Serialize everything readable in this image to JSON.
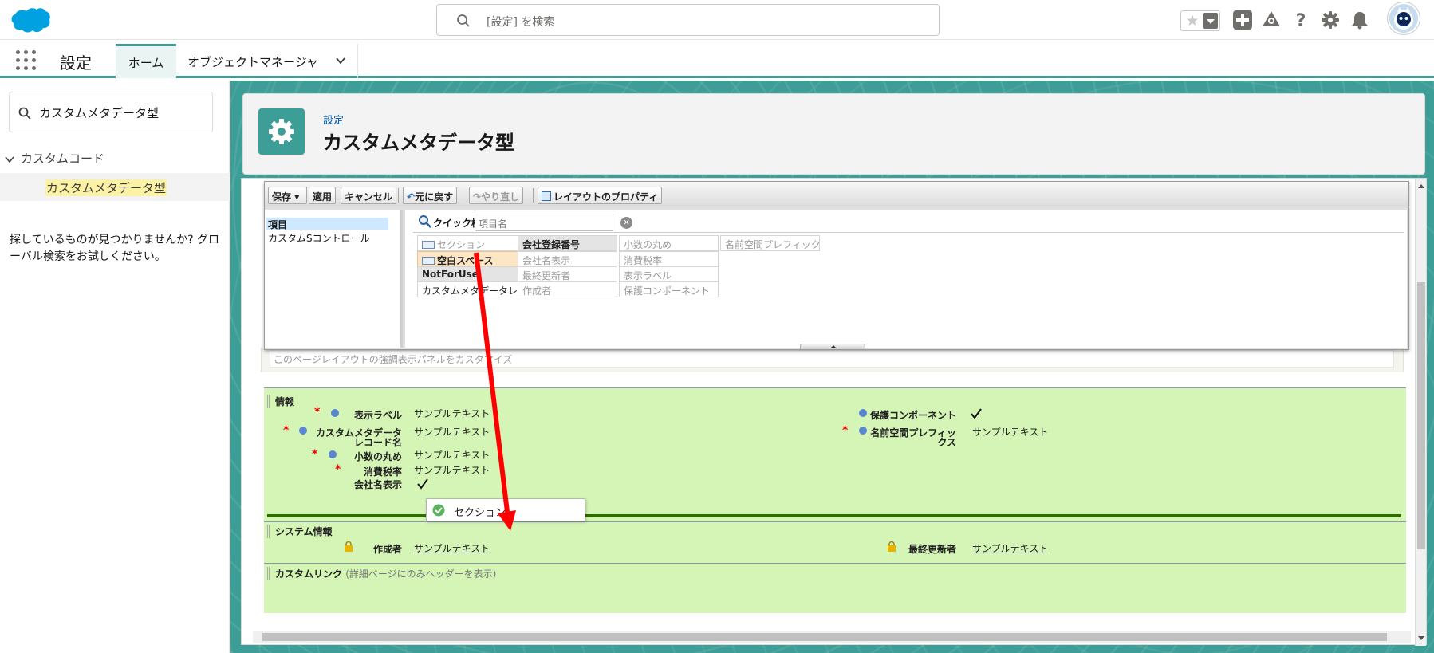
{
  "header": {
    "search_placeholder": "[設定] を検索"
  },
  "nav": {
    "app_title": "設定",
    "tabs": [
      {
        "label": "ホーム"
      },
      {
        "label": "オブジェクトマネージャ"
      }
    ]
  },
  "sidebar": {
    "search_value": "カスタムメタデータ型",
    "group_label": "カスタムコード",
    "item_label": "カスタムメタデータ型",
    "help_text": "探しているものが見つかりませんか? グローバル検索をお試しください。"
  },
  "page_header": {
    "breadcrumb": "設定",
    "title": "カスタムメタデータ型"
  },
  "toolbar": {
    "save_label": "保存",
    "apply_label": "適用",
    "cancel_label": "キャンセル",
    "undo_label": "元に戻す",
    "redo_label": "やり直し",
    "layout_props_label": "レイアウトのプロパティ"
  },
  "palette": {
    "categories": [
      "項目",
      "カスタムSコントロール"
    ],
    "quick_search_label": "クイック検索",
    "quick_search_placeholder": "項目名",
    "fields": {
      "section": "セクション",
      "blank_space": "空白スペース",
      "notforuse": "NotForUse",
      "cmdt_record": "カスタムメタデータレコード名",
      "company_reg": "会社登録番号",
      "company_disp": "会社名表示",
      "last_modified": "最終更新者",
      "created_by": "作成者",
      "decimal_round": "小数の丸め",
      "tax_rate": "消費税率",
      "display_label": "表示ラベル",
      "protected": "保護コンポーネント",
      "namespace": "名前空間プレフィックス"
    }
  },
  "highlights": {
    "text": "このページレイアウトの強調表示パネルをカスタマイズ"
  },
  "layout": {
    "info_title": "情報",
    "left_fields": [
      {
        "label": "表示ラベル",
        "value": "サンプルテキスト"
      },
      {
        "label": "カスタムメタデータレコード名",
        "value": "サンプルテキスト"
      },
      {
        "label": "小数の丸め",
        "value": "サンプルテキスト"
      },
      {
        "label": "消費税率",
        "value": "サンプルテキスト"
      },
      {
        "label": "会社名表示",
        "value": ""
      }
    ],
    "right_fields": [
      {
        "label": "保護コンポーネント",
        "value": ""
      },
      {
        "label": "名前空間プレフィックス",
        "value": "サンプルテキスト"
      }
    ],
    "system_title": "システム情報",
    "system_fields": [
      {
        "label": "作成者",
        "value": "サンプルテキスト"
      },
      {
        "label": "最終更新者",
        "value": "サンプルテキスト"
      }
    ],
    "custom_links_title": "カスタムリンク",
    "custom_links_sub": "(詳細ページにのみヘッダーを表示)",
    "drag_label": "セクション"
  },
  "colors": {
    "brand": "#3c9e97",
    "layout_bg": "#d4f5b6",
    "required": "#e00000",
    "arrow": "#ff0000"
  }
}
